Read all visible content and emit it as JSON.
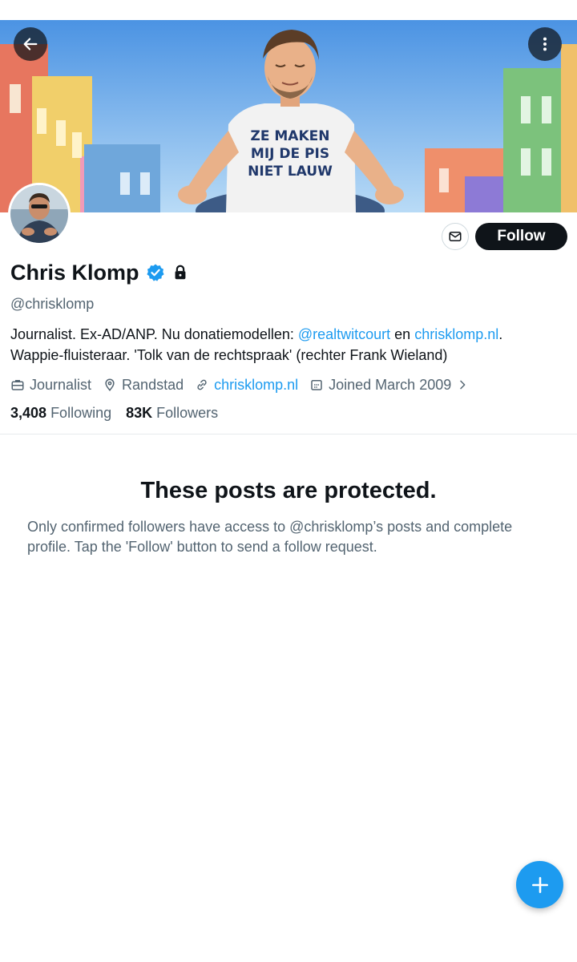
{
  "header": {
    "back_icon": "arrow-left-icon",
    "more_icon": "more-vertical-icon",
    "banner_shirt_text": [
      "ZE MAKEN",
      "MIJ DE PIS",
      "NIET LAUW"
    ]
  },
  "profile": {
    "name": "Chris Klomp",
    "verified_icon": "verified-badge-icon",
    "protected_icon": "lock-icon",
    "handle": "@chrisklomp",
    "bio": {
      "part1": "Journalist. Ex-AD/ANP. Nu donatiemodellen: ",
      "mention": "@realtwitcourt",
      "part2": " en ",
      "link": "chrisklomp.nl",
      "part3": ".",
      "line2": "Wappie-fluisteraar. 'Tolk van de rechtspraak' (rechter Frank Wieland)"
    },
    "meta": {
      "profession": "Journalist",
      "location": "Randstad",
      "website": "chrisklomp.nl",
      "joined": "Joined March 2009"
    },
    "stats": {
      "following_count": "3,408",
      "following_label": "Following",
      "followers_count": "83K",
      "followers_label": "Followers"
    }
  },
  "actions": {
    "message_icon": "envelope-icon",
    "follow_label": "Follow"
  },
  "protected": {
    "title": "These posts are protected.",
    "text": "Only confirmed followers have access to @chrisklomp’s posts and complete profile. Tap the 'Follow' button to send a follow request."
  },
  "fab": {
    "icon": "plus-icon"
  },
  "colors": {
    "accent": "#1d9bf0",
    "text": "#0f1419",
    "secondary": "#536471",
    "button_dark": "#0f1419"
  }
}
